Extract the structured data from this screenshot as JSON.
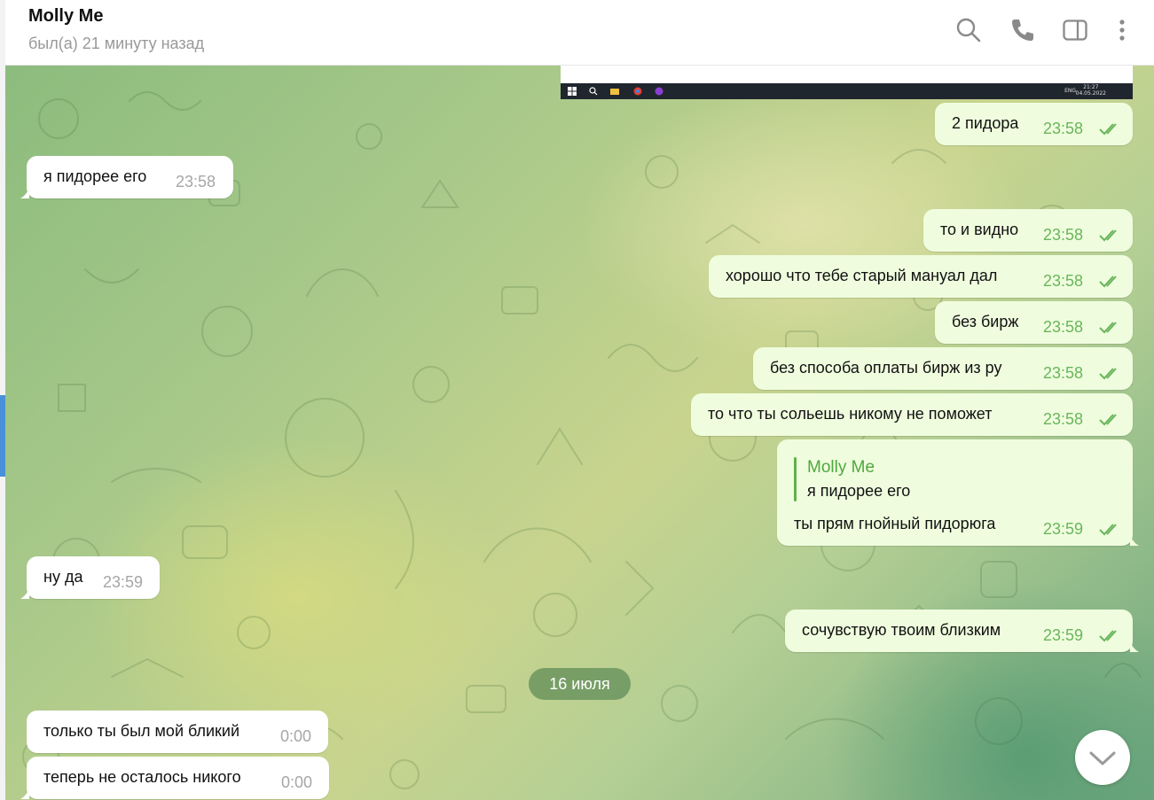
{
  "header": {
    "title": "Molly Me",
    "status": "был(а) 21 минуту назад"
  },
  "shared_screenshot": {
    "lang": "ENG",
    "clock_time": "21:27",
    "clock_date": "04.05.2022"
  },
  "messages": [
    {
      "dir": "out",
      "text": "2 пидора",
      "time": "23:58"
    },
    {
      "dir": "in",
      "text": "я пидорее его",
      "time": "23:58"
    },
    {
      "dir": "out",
      "text": "то и видно",
      "time": "23:58"
    },
    {
      "dir": "out",
      "text": "хорошо что тебе старый мануал дал",
      "time": "23:58"
    },
    {
      "dir": "out",
      "text": "без бирж",
      "time": "23:58"
    },
    {
      "dir": "out",
      "text": "без способа оплаты бирж из ру",
      "time": "23:58"
    },
    {
      "dir": "out",
      "text": "то что ты сольешь никому не поможет",
      "time": "23:58"
    },
    {
      "dir": "out",
      "reply_name": "Molly Me",
      "reply_text": "я пидорее его",
      "text": "ты прям гнойный пидорюга",
      "time": "23:59"
    },
    {
      "dir": "in",
      "text": "ну да",
      "time": "23:59"
    },
    {
      "dir": "out",
      "text": "сочувствую твоим близким",
      "time": "23:59"
    },
    {
      "dir": "in",
      "text": "только ты был мой бликий",
      "time": "0:00"
    },
    {
      "dir": "in",
      "text": "теперь не осталось никого",
      "time": "0:00"
    }
  ],
  "date_separator": "16 июля",
  "colors": {
    "outgoing_bubble": "#effdde",
    "incoming_bubble": "#ffffff",
    "accent_green": "#4ea83d",
    "date_pill": "#6c8f5e"
  },
  "icons": [
    "search-icon",
    "phone-icon",
    "sidebar-toggle-icon",
    "more-vertical-icon",
    "chevron-down-icon",
    "double-check-icon"
  ]
}
